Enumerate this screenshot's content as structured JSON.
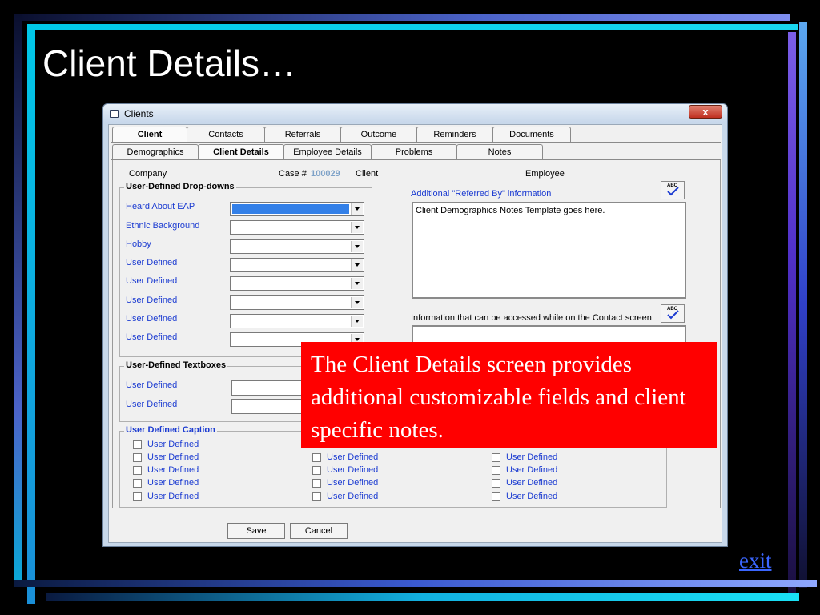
{
  "slide": {
    "title": "Client Details…",
    "exit_label": "exit"
  },
  "window": {
    "title": "Clients",
    "close_symbol": "x"
  },
  "tabs_main": [
    "Client",
    "Contacts",
    "Referrals",
    "Outcome",
    "Reminders",
    "Documents"
  ],
  "tabs_sub": [
    "Demographics",
    "Client Details",
    "Employee Details",
    "Problems",
    "Notes"
  ],
  "header": {
    "company_label": "Company",
    "case_label": "Case #",
    "case_number": "100029",
    "client_label": "Client",
    "employee_label": "Employee"
  },
  "dropdowns": {
    "title": "User-Defined Drop-downs",
    "fields": [
      "Heard About EAP",
      "Ethnic Background",
      "Hobby",
      "User Defined",
      "User Defined",
      "User Defined",
      "User Defined",
      "User Defined"
    ]
  },
  "textboxes": {
    "title": "User-Defined Textboxes",
    "fields": [
      "User Defined",
      "User Defined"
    ]
  },
  "captions": {
    "title": "User Defined Caption",
    "col1": [
      "User Defined",
      "User Defined",
      "User Defined",
      "User Defined",
      "User Defined"
    ],
    "col2": [
      "User Defined",
      "User Defined",
      "User Defined",
      "User Defined"
    ],
    "col3": [
      "User Defined",
      "User Defined",
      "User Defined",
      "User Defined"
    ]
  },
  "notes": {
    "referred_label": "Additional \"Referred By\" information",
    "referred_text": "Client Demographics Notes Template goes here.",
    "contact_label": "Information that can be accessed while on the Contact screen"
  },
  "spell_icon_text": "ABC",
  "buttons": {
    "save": "Save",
    "cancel": "Cancel"
  },
  "callout": "The Client Details screen provides additional customizable fields and client specific notes."
}
